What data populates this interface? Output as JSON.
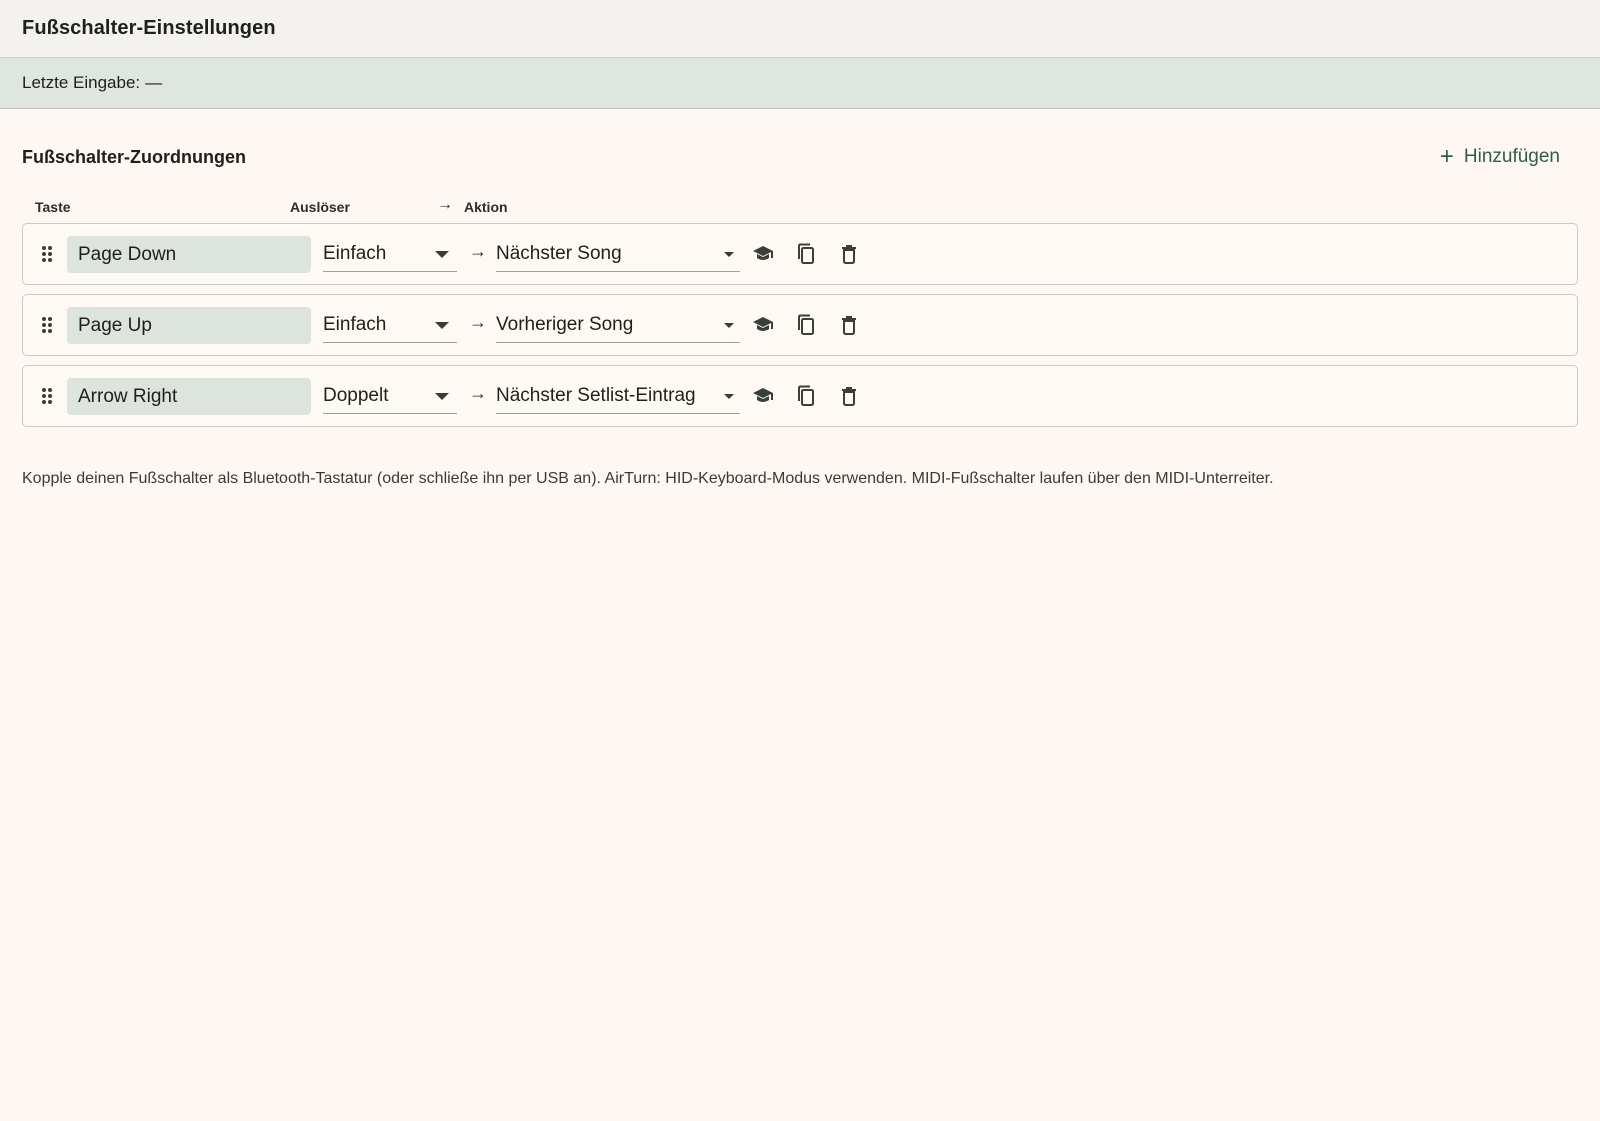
{
  "window": {
    "title": "Fußschalter-Einstellungen"
  },
  "status": {
    "label": "Letzte Eingabe:",
    "value": "—"
  },
  "section": {
    "title": "Fußschalter-Zuordnungen",
    "add_label": "Hinzufügen",
    "add_icon": "plus-icon"
  },
  "columns": {
    "key": "Taste",
    "trigger": "Auslöser",
    "arrow": "→",
    "action": "Aktion"
  },
  "mappings": [
    {
      "key": "Page Down",
      "trigger": "Einfach",
      "action": "Nächster Song"
    },
    {
      "key": "Page Up",
      "trigger": "Einfach",
      "action": "Vorheriger Song"
    },
    {
      "key": "Arrow Right",
      "trigger": "Doppelt",
      "action": "Nächster Setlist-Eintrag"
    }
  ],
  "row_arrow": "→",
  "row_icons": [
    "drag-handle-icon",
    "learn-icon",
    "copy-icon",
    "delete-icon"
  ],
  "hint": "Kopple deinen Fußschalter als Bluetooth-Tastatur (oder schließe ihn per USB an). AirTurn: HID-Keyboard-Modus verwenden. MIDI-Fußschalter laufen über den MIDI-Unterreiter.",
  "colors": {
    "background": "#fff8f2",
    "title_bar": "#f3f2ee",
    "status_bar": "#dfe5df",
    "key_field": "#dde3dd",
    "accent": "#2b5f48",
    "icon": "#3a3f3b"
  }
}
